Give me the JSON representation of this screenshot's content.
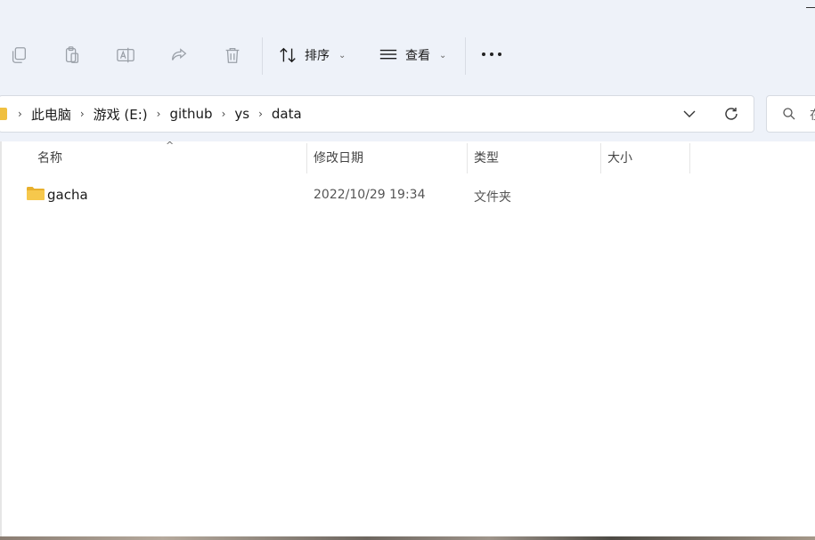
{
  "toolbar": {
    "sort_label": "排序",
    "view_label": "查看",
    "icons": [
      "copy-icon",
      "paste-icon",
      "rename-icon",
      "share-icon",
      "delete-icon",
      "sort-icon",
      "view-icon",
      "more-icon"
    ]
  },
  "breadcrumb": {
    "items": [
      "此电脑",
      "游戏 (E:)",
      "github",
      "ys",
      "data"
    ]
  },
  "search": {
    "placeholder": "在"
  },
  "columns": {
    "name": "名称",
    "modified": "修改日期",
    "type": "类型",
    "size": "大小"
  },
  "files": [
    {
      "name": "gacha",
      "modified": "2022/10/29 19:34",
      "type": "文件夹",
      "size": ""
    }
  ],
  "colors": {
    "chrome_bg": "#eef2f9",
    "folder": "#f0c040"
  }
}
